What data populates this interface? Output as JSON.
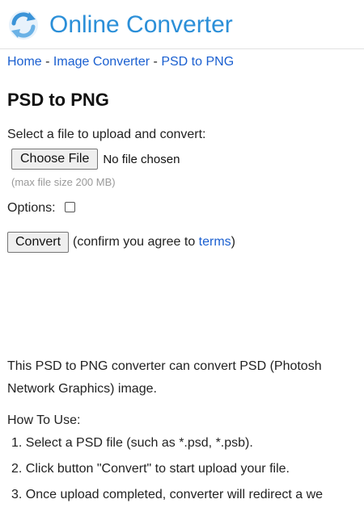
{
  "header": {
    "site_title": "Online Converter",
    "logo_icon": "refresh-arrows-icon",
    "accent_color": "#2b8fd8"
  },
  "breadcrumb": {
    "items": [
      "Home",
      "Image Converter",
      "PSD to PNG"
    ],
    "separator": "-"
  },
  "page": {
    "title": "PSD to PNG"
  },
  "upload": {
    "label": "Select a file to upload and convert:",
    "choose_button": "Choose File",
    "file_status": "No file chosen",
    "max_size": "(max file size 200 MB)"
  },
  "options": {
    "label": "Options:",
    "checked": false
  },
  "convert": {
    "button": "Convert",
    "confirm_prefix": "(confirm you agree to ",
    "terms_link": "terms",
    "confirm_suffix": ")"
  },
  "description": {
    "line1": "This PSD to PNG converter can convert PSD (Photosh",
    "line2": "Network Graphics) image."
  },
  "how_to": {
    "title": "How To Use:",
    "steps": [
      "1. Select a PSD file (such as *.psd, *.psb).",
      "2. Click button \"Convert\" to start upload your file.",
      "3. Once upload completed, converter will redirect a we"
    ]
  }
}
